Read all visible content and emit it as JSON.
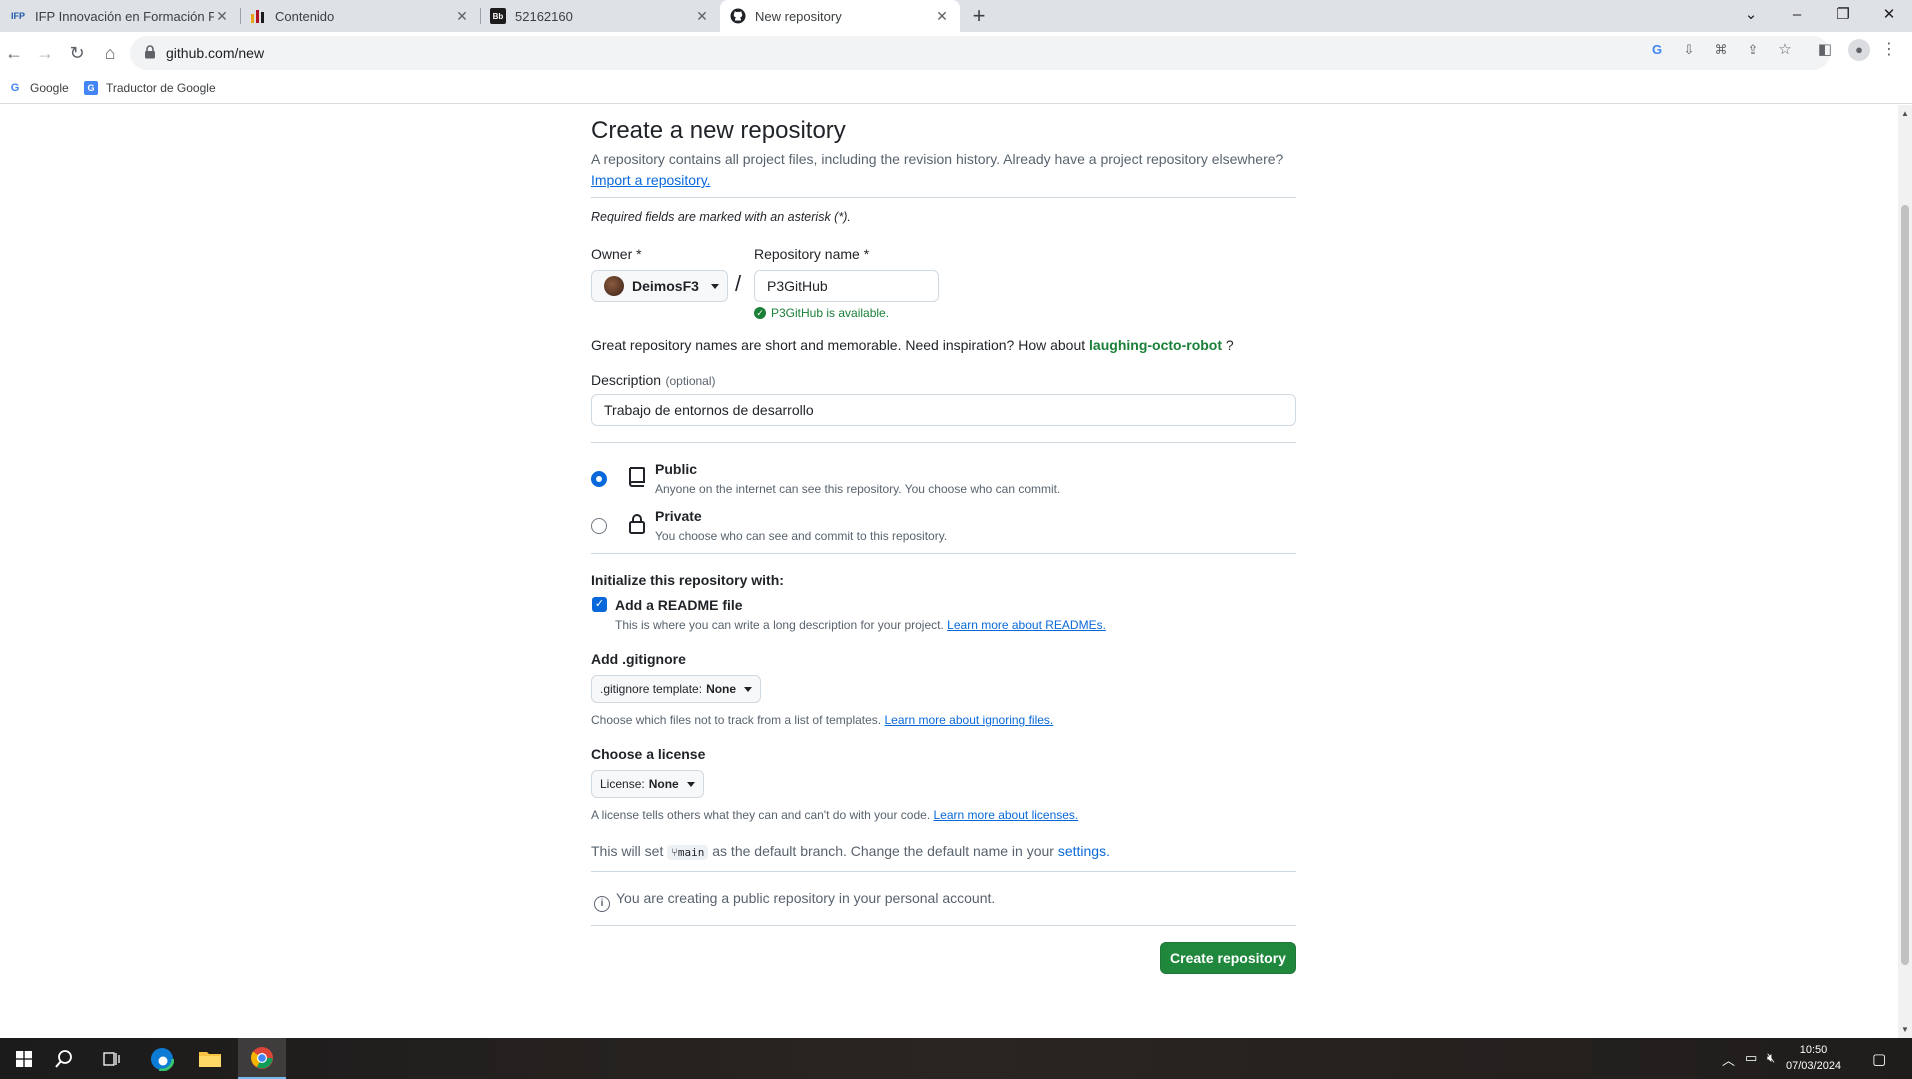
{
  "browser": {
    "tabs": [
      {
        "title": "IFP Innovación en Formación Pr",
        "favicon": "IFP"
      },
      {
        "title": "Contenido",
        "favicon": "bars"
      },
      {
        "title": "52162160",
        "favicon": "Bb"
      },
      {
        "title": "New repository",
        "favicon": "github"
      }
    ],
    "active_tab": 3,
    "url": "github.com/new",
    "bookmarks": [
      {
        "label": "Google",
        "icon": "G"
      },
      {
        "label": "Traductor de Google",
        "icon": "G"
      }
    ]
  },
  "page": {
    "title": "Create a new repository",
    "intro_text": "A repository contains all project files, including the revision history. Already have a project repository elsewhere?",
    "import_link": "Import a repository.",
    "required_note": "Required fields are marked with an asterisk (*).",
    "owner_label": "Owner *",
    "owner_value": "DeimosF3",
    "slash": "/",
    "repo_name_label": "Repository name *",
    "repo_name_value": "P3GitHub",
    "availability": "P3GitHub is available.",
    "inspiration_prefix": "Great repository names are short and memorable. Need inspiration? How about",
    "inspiration_name": "laughing-octo-robot",
    "inspiration_suffix": "?",
    "description_label": "Description",
    "description_optional": "(optional)",
    "description_value": "Trabajo de entornos de desarrollo",
    "visibility": {
      "selected": "public",
      "public_label": "Public",
      "public_desc": "Anyone on the internet can see this repository. You choose who can commit.",
      "private_label": "Private",
      "private_desc": "You choose who can see and commit to this repository."
    },
    "init_heading": "Initialize this repository with:",
    "readme_label": "Add a README file",
    "readme_checked": true,
    "readme_desc": "This is where you can write a long description for your project.",
    "readme_link": "Learn more about READMEs.",
    "gitignore_heading": "Add .gitignore",
    "gitignore_select_prefix": ".gitignore template:",
    "gitignore_select_value": "None",
    "gitignore_desc": "Choose which files not to track from a list of templates.",
    "gitignore_link": "Learn more about ignoring files.",
    "license_heading": "Choose a license",
    "license_select_prefix": "License:",
    "license_select_value": "None",
    "license_desc": "A license tells others what they can and can't do with your code.",
    "license_link": "Learn more about licenses.",
    "branch_prefix": "This will set",
    "branch_name": "main",
    "branch_middle": "as the default branch. Change the default name in your",
    "branch_link": "settings.",
    "info_text": "You are creating a public repository in your personal account.",
    "create_button": "Create repository"
  },
  "taskbar": {
    "time": "10:50",
    "date": "07/03/2024"
  },
  "colors": {
    "accent_blue": "#0969da",
    "success_green": "#1a7f37",
    "button_green": "#1f883d"
  }
}
